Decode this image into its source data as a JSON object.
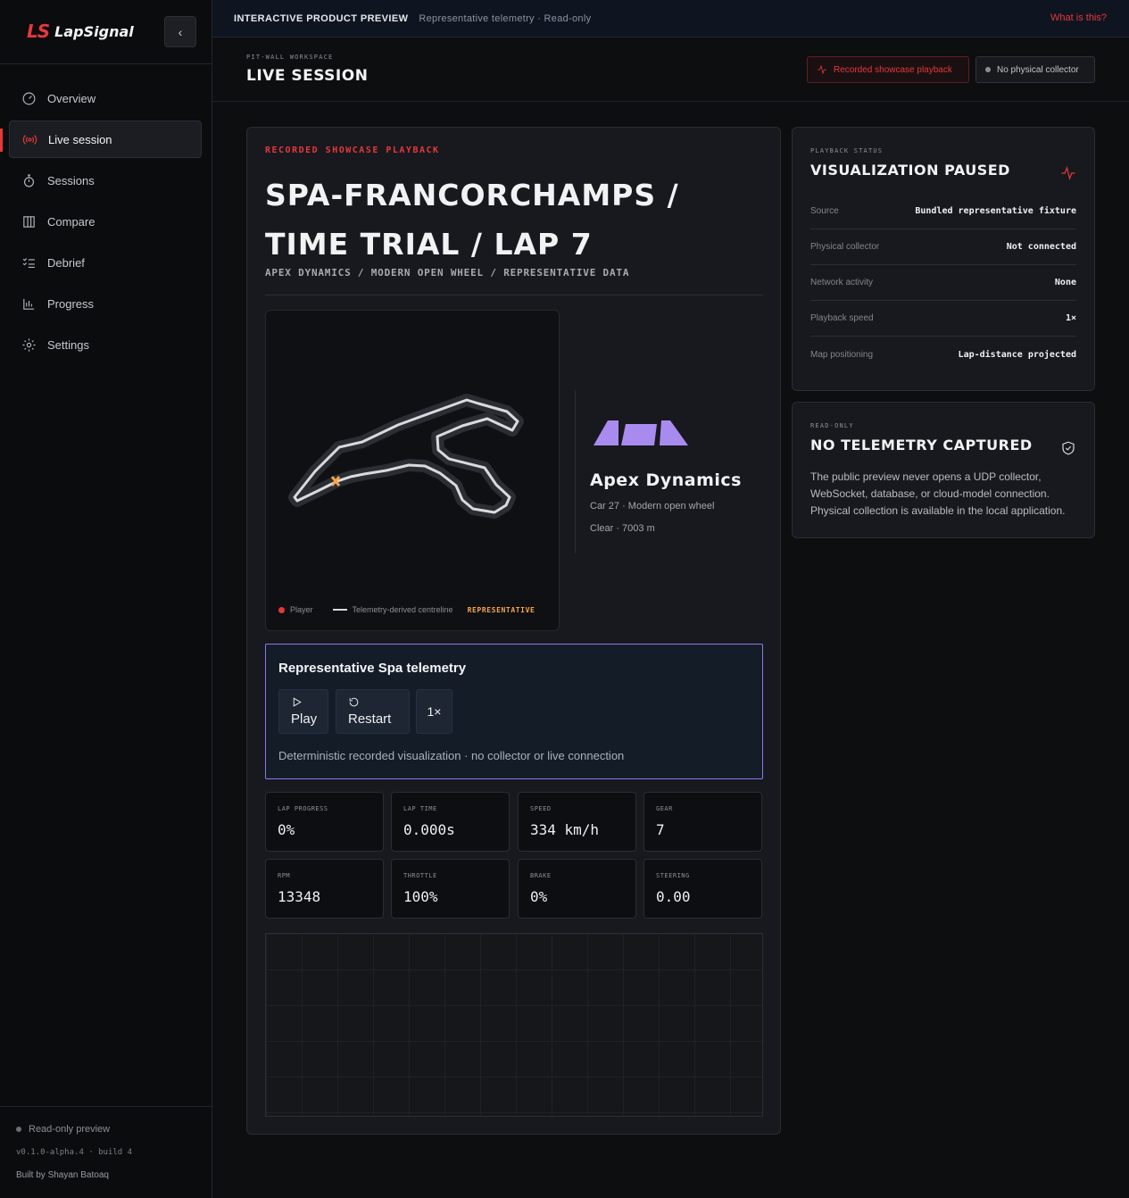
{
  "brand": {
    "mark": "LS",
    "name": "LapSignal",
    "collapse_icon": "chevron-left-icon"
  },
  "nav": [
    {
      "label": "Overview",
      "icon": "gauge-icon",
      "active": false
    },
    {
      "label": "Live session",
      "icon": "broadcast-icon",
      "active": true
    },
    {
      "label": "Sessions",
      "icon": "stopwatch-icon",
      "active": false
    },
    {
      "label": "Compare",
      "icon": "columns-icon",
      "active": false
    },
    {
      "label": "Debrief",
      "icon": "checklist-icon",
      "active": false
    },
    {
      "label": "Progress",
      "icon": "bar-chart-icon",
      "active": false
    },
    {
      "label": "Settings",
      "icon": "gear-icon",
      "active": false
    }
  ],
  "sidebar_footer": {
    "status": "Read-only preview",
    "version": "v0.1.0-alpha.4 · build 4",
    "built_by": "Built by Shayan Batoaq"
  },
  "banner": {
    "title": "INTERACTIVE PRODUCT PREVIEW",
    "subtitle": "Representative telemetry · Read-only",
    "link": "What is this?"
  },
  "header": {
    "eyebrow": "PIT-WALL WORKSPACE",
    "title": "LIVE SESSION",
    "pill_playback": "Recorded showcase playback",
    "pill_collector": "No physical collector"
  },
  "session": {
    "eyebrow": "RECORDED SHOWCASE PLAYBACK",
    "title": "SPA-FRANCORCHAMPS / TIME TRIAL / LAP 7",
    "subtitle": "APEX DYNAMICS / MODERN OPEN WHEEL / REPRESENTATIVE DATA"
  },
  "map": {
    "legend_player": "Player",
    "legend_line": "Telemetry-derived centreline",
    "legend_tag": "REPRESENTATIVE",
    "player_progress": 0
  },
  "team": {
    "name": "Apex Dynamics",
    "car": "Car 27 · Modern open wheel",
    "conditions": "Clear · 7003 m",
    "accent": "#a98bf0"
  },
  "player": {
    "title": "Representative Spa telemetry",
    "play": "Play",
    "restart": "Restart",
    "speed": "1×",
    "note": "Deterministic recorded visualization · no collector or live connection"
  },
  "metrics": [
    {
      "label": "LAP PROGRESS",
      "value": "0%"
    },
    {
      "label": "LAP TIME",
      "value": "0.000s"
    },
    {
      "label": "SPEED",
      "value": "334 km/h"
    },
    {
      "label": "GEAR",
      "value": "7"
    },
    {
      "label": "RPM",
      "value": "13348"
    },
    {
      "label": "THROTTLE",
      "value": "100%"
    },
    {
      "label": "BRAKE",
      "value": "0%"
    },
    {
      "label": "STEERING",
      "value": "0.00"
    }
  ],
  "playback_status": {
    "eyebrow": "PLAYBACK STATUS",
    "title": "VISUALIZATION PAUSED",
    "icon": "pulse-icon",
    "rows": [
      {
        "key": "Source",
        "value": "Bundled representative fixture"
      },
      {
        "key": "Physical collector",
        "value": "Not connected"
      },
      {
        "key": "Network activity",
        "value": "None"
      },
      {
        "key": "Playback speed",
        "value": "1×"
      },
      {
        "key": "Map positioning",
        "value": "Lap-distance projected"
      }
    ]
  },
  "readonly": {
    "eyebrow": "READ-ONLY",
    "title": "NO TELEMETRY CAPTURED",
    "icon": "shield-check-icon",
    "body": "The public preview never opens a UDP collector, WebSocket, database, or cloud-model connection. Physical collection is available in the local application."
  },
  "colors": {
    "accent_red": "#e5383b",
    "accent_violet": "#8b79e6",
    "tag_orange": "#f5a54a"
  }
}
